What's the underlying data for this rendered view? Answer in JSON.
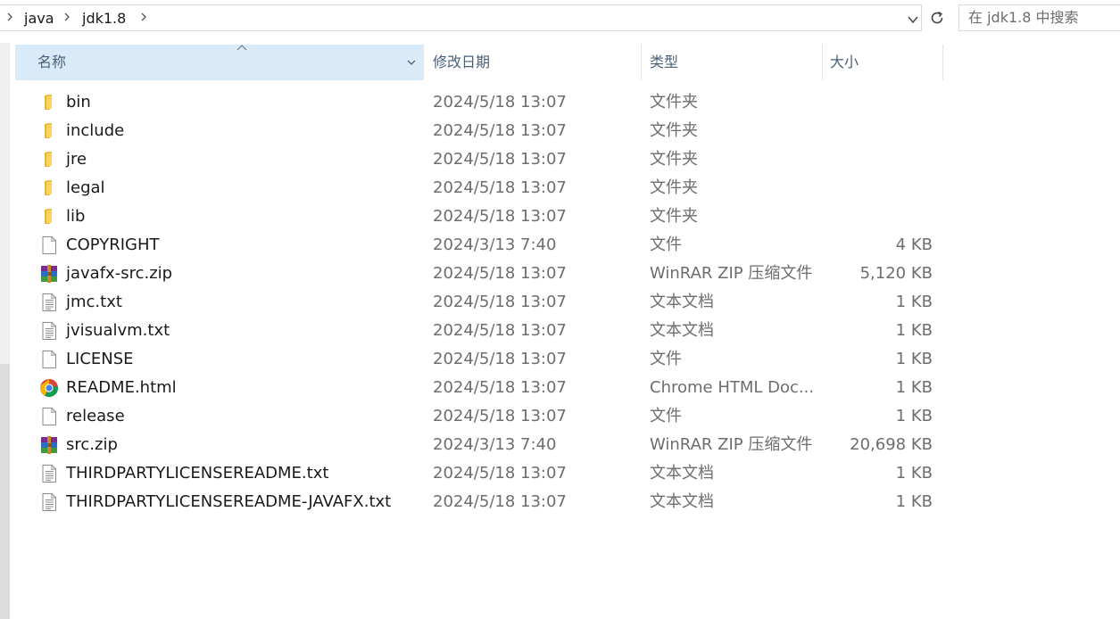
{
  "address_bar": {
    "breadcrumbs": [
      "java",
      "jdk1.8"
    ],
    "dropdown_icon": "chevron-down-icon",
    "refresh_icon": "refresh-icon"
  },
  "search": {
    "placeholder": "在 jdk1.8 中搜索"
  },
  "columns": {
    "name": "名称",
    "date": "修改日期",
    "type": "类型",
    "size": "大小"
  },
  "files": [
    {
      "name": "bin",
      "date": "2024/5/18 13:07",
      "type": "文件夹",
      "size": "",
      "icon": "folder-icon"
    },
    {
      "name": "include",
      "date": "2024/5/18 13:07",
      "type": "文件夹",
      "size": "",
      "icon": "folder-icon"
    },
    {
      "name": "jre",
      "date": "2024/5/18 13:07",
      "type": "文件夹",
      "size": "",
      "icon": "folder-icon"
    },
    {
      "name": "legal",
      "date": "2024/5/18 13:07",
      "type": "文件夹",
      "size": "",
      "icon": "folder-icon"
    },
    {
      "name": "lib",
      "date": "2024/5/18 13:07",
      "type": "文件夹",
      "size": "",
      "icon": "folder-icon"
    },
    {
      "name": "COPYRIGHT",
      "date": "2024/3/13 7:40",
      "type": "文件",
      "size": "4 KB",
      "icon": "blank-file-icon"
    },
    {
      "name": "javafx-src.zip",
      "date": "2024/5/18 13:07",
      "type": "WinRAR ZIP 压缩文件",
      "size": "5,120 KB",
      "icon": "winrar-archive-icon"
    },
    {
      "name": "jmc.txt",
      "date": "2024/5/18 13:07",
      "type": "文本文档",
      "size": "1 KB",
      "icon": "text-file-icon"
    },
    {
      "name": "jvisualvm.txt",
      "date": "2024/5/18 13:07",
      "type": "文本文档",
      "size": "1 KB",
      "icon": "text-file-icon"
    },
    {
      "name": "LICENSE",
      "date": "2024/5/18 13:07",
      "type": "文件",
      "size": "1 KB",
      "icon": "blank-file-icon"
    },
    {
      "name": "README.html",
      "date": "2024/5/18 13:07",
      "type": "Chrome HTML Doc...",
      "size": "1 KB",
      "icon": "chrome-icon"
    },
    {
      "name": "release",
      "date": "2024/5/18 13:07",
      "type": "文件",
      "size": "1 KB",
      "icon": "blank-file-icon"
    },
    {
      "name": "src.zip",
      "date": "2024/3/13 7:40",
      "type": "WinRAR ZIP 压缩文件",
      "size": "20,698 KB",
      "icon": "winrar-archive-icon"
    },
    {
      "name": "THIRDPARTYLICENSEREADME.txt",
      "date": "2024/5/18 13:07",
      "type": "文本文档",
      "size": "1 KB",
      "icon": "text-file-icon"
    },
    {
      "name": "THIRDPARTYLICENSEREADME-JAVAFX.txt",
      "date": "2024/5/18 13:07",
      "type": "文本文档",
      "size": "1 KB",
      "icon": "text-file-icon"
    }
  ]
}
